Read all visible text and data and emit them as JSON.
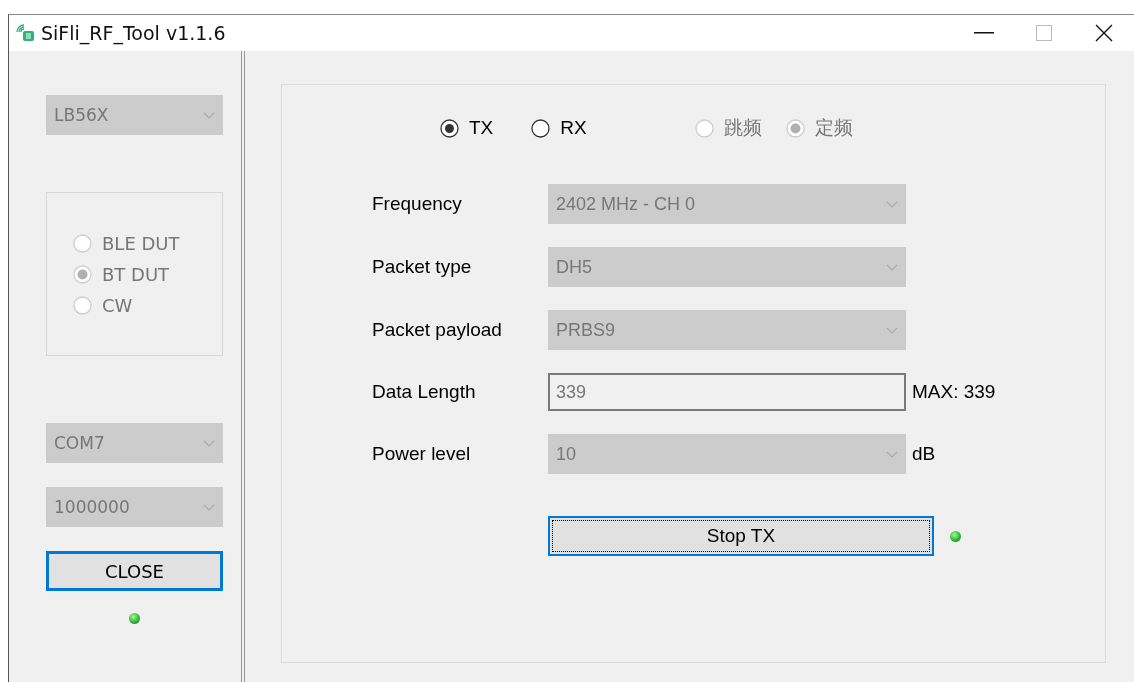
{
  "window": {
    "title": "SiFli_RF_Tool v1.1.6"
  },
  "left_panel": {
    "chip_select": {
      "value": "LB56X",
      "disabled": true
    },
    "modes": [
      {
        "label": "BLE DUT",
        "selected": false,
        "disabled": true
      },
      {
        "label": "BT DUT",
        "selected": true,
        "disabled": true
      },
      {
        "label": "CW",
        "selected": false,
        "disabled": true
      }
    ],
    "port_select": {
      "value": "COM7",
      "disabled": true
    },
    "baud_select": {
      "value": "1000000",
      "disabled": true
    },
    "close_button": {
      "label": "CLOSE",
      "focused": true
    }
  },
  "main": {
    "direction": [
      {
        "label": "TX",
        "selected": true,
        "disabled": false
      },
      {
        "label": "RX",
        "selected": false,
        "disabled": false
      }
    ],
    "hop_mode": [
      {
        "label": "跳频",
        "selected": false,
        "disabled": true
      },
      {
        "label": "定频",
        "selected": true,
        "disabled": true
      }
    ],
    "fields": [
      {
        "kind": "select",
        "label": "Frequency",
        "value": "2402 MHz - CH 0",
        "disabled": true
      },
      {
        "kind": "select",
        "label": "Packet type",
        "value": "DH5",
        "disabled": true
      },
      {
        "kind": "select",
        "label": "Packet payload",
        "value": "PRBS9",
        "disabled": true
      },
      {
        "kind": "input",
        "label": "Data Length",
        "value": "339",
        "disabled": true,
        "suffix": "MAX: 339"
      },
      {
        "kind": "select",
        "label": "Power level",
        "value": "10",
        "disabled": true,
        "suffix": "dB"
      }
    ],
    "action_button": {
      "label": "Stop TX",
      "focused": true
    }
  }
}
